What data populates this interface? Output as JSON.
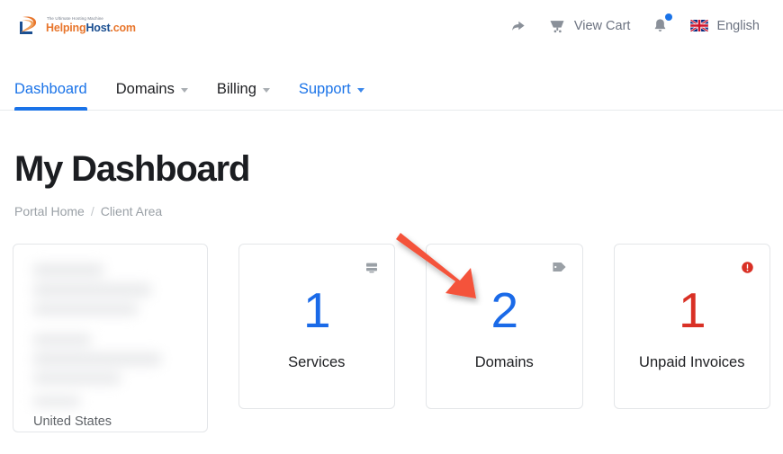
{
  "header": {
    "logo": {
      "tagline": "The Ultimate Hosting Machine",
      "name_part1": "Helping",
      "name_part2": "Host",
      "name_part3": ".com",
      "icon": "swirl-logo-icon"
    },
    "actions": [
      {
        "icon": "share-arrow-icon",
        "label": ""
      },
      {
        "icon": "shopping-cart-icon",
        "label": "View Cart"
      },
      {
        "icon": "bell-notification-icon",
        "label": ""
      },
      {
        "icon": "uk-flag-icon",
        "label": "English"
      }
    ],
    "share_label": "",
    "cart_label": "View Cart",
    "language_label": "English"
  },
  "nav": {
    "tabs": [
      {
        "label": "Dashboard",
        "active": true,
        "has_caret": false,
        "style": "blue"
      },
      {
        "label": "Domains",
        "active": false,
        "has_caret": true,
        "style": "dark"
      },
      {
        "label": "Billing",
        "active": false,
        "has_caret": true,
        "style": "dark"
      },
      {
        "label": "Support",
        "active": false,
        "has_caret": true,
        "style": "blue"
      }
    ]
  },
  "page": {
    "title": "My Dashboard",
    "breadcrumb": {
      "home": "Portal Home",
      "separator": "/",
      "current": "Client Area"
    }
  },
  "cards": [
    {
      "type": "profile",
      "icon": "",
      "value": "",
      "label": "",
      "country": "United States",
      "redacted": true
    },
    {
      "type": "stat",
      "icon": "server-icon",
      "value": "1",
      "label": "Services",
      "color": "#1a6ae8"
    },
    {
      "type": "stat",
      "icon": "tag-icon",
      "value": "2",
      "label": "Domains",
      "color": "#1a6ae8"
    },
    {
      "type": "stat",
      "icon": "alert-circle-icon",
      "value": "1",
      "label": "Unpaid Invoices",
      "color": "#d93025"
    }
  ],
  "annotation": {
    "type": "arrow",
    "color": "#f4523b",
    "points_to": "Domains"
  },
  "colors": {
    "accent_blue": "#1a73e8",
    "stat_blue": "#1a6ae8",
    "alert_red": "#d93025",
    "arrow_red": "#f4523b",
    "text_dark": "#202124",
    "text_muted": "#9aa0a6",
    "border": "#e4e6e9"
  }
}
